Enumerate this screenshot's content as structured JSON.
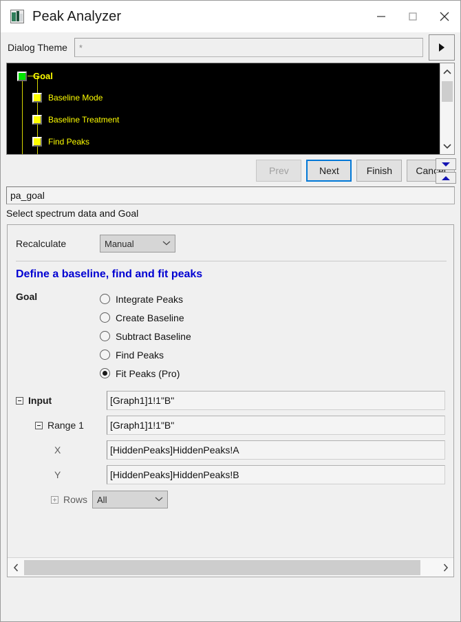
{
  "window": {
    "title": "Peak Analyzer",
    "app_icon": "peak-analyzer-icon",
    "minimize_icon": "minimize-icon",
    "maximize_icon": "maximize-icon",
    "close_icon": "close-icon"
  },
  "theme": {
    "label": "Dialog Theme",
    "value": "*",
    "arrow_button_icon": "triangle-right-icon"
  },
  "tree": {
    "nodes": [
      {
        "label": "Goal",
        "marker": "green",
        "level": 0,
        "bold": true
      },
      {
        "label": "Baseline Mode",
        "marker": "yellow",
        "level": 1,
        "bold": false
      },
      {
        "label": "Baseline Treatment",
        "marker": "yellow",
        "level": 1,
        "bold": false
      },
      {
        "label": "Find Peaks",
        "marker": "yellow",
        "level": 1,
        "bold": false
      }
    ],
    "scroll_up_icon": "chevron-up-icon",
    "scroll_down_icon": "chevron-down-icon",
    "background_color": "#000000",
    "text_color": "#ffff00"
  },
  "nav": {
    "prev": "Prev",
    "next": "Next",
    "finish": "Finish",
    "cancel": "Cancel",
    "prev_disabled": true,
    "next_focused": true,
    "spinner_down_icon": "triangle-down-icon",
    "spinner_up_icon": "triangle-up-icon"
  },
  "identifier": {
    "value": "pa_goal"
  },
  "description": {
    "text": "Select spectrum data and Goal"
  },
  "settings": {
    "recalculate": {
      "label": "Recalculate",
      "value": "Manual",
      "chevron_icon": "chevron-down-icon"
    },
    "headline": "Define a baseline, find and fit peaks",
    "goal": {
      "label": "Goal",
      "options": [
        {
          "label": "Integrate Peaks",
          "selected": false
        },
        {
          "label": "Create Baseline",
          "selected": false
        },
        {
          "label": "Subtract Baseline",
          "selected": false
        },
        {
          "label": "Find Peaks",
          "selected": false
        },
        {
          "label": "Fit Peaks (Pro)",
          "selected": true
        }
      ]
    },
    "input": {
      "label": "Input",
      "value": "[Graph1]1!1\"B\"",
      "expander": "minus",
      "range": {
        "label": "Range 1",
        "value": "[Graph1]1!1\"B\"",
        "expander": "minus"
      },
      "x": {
        "label": "X",
        "value": "[HiddenPeaks]HiddenPeaks!A"
      },
      "y": {
        "label": "Y",
        "value": "[HiddenPeaks]HiddenPeaks!B"
      },
      "rows": {
        "label": "Rows",
        "value": "All",
        "expander": "plus",
        "chevron_icon": "chevron-down-icon"
      }
    }
  },
  "panel_scroll": {
    "left_icon": "chevron-left-icon",
    "right_icon": "chevron-right-icon"
  }
}
